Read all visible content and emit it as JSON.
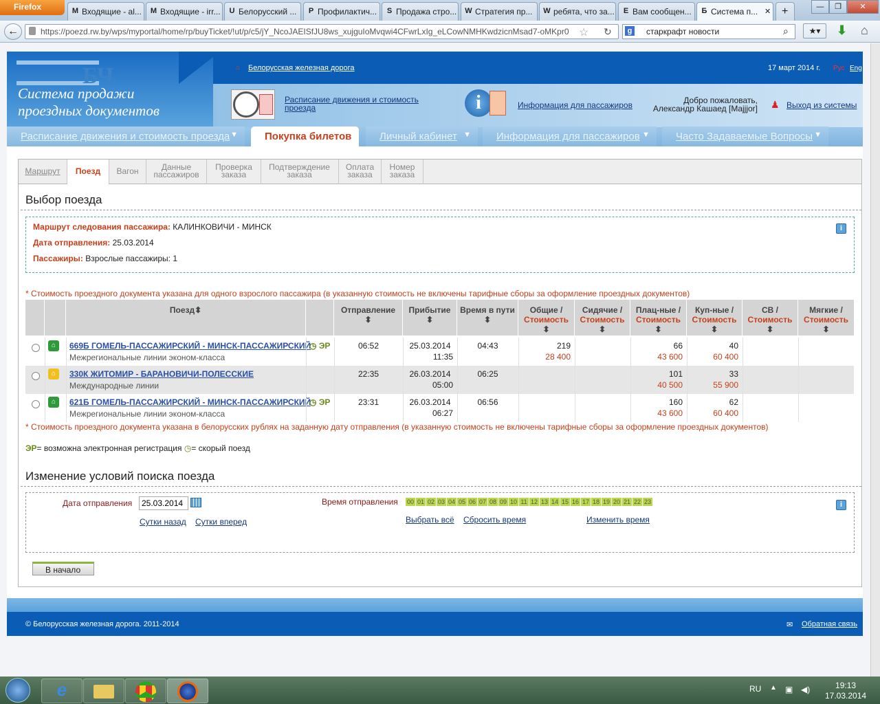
{
  "browser": {
    "app_button": "Firefox",
    "tabs": [
      {
        "label": "Входящие - al...",
        "icon": "M"
      },
      {
        "label": "Входящие - irr...",
        "icon": "M"
      },
      {
        "label": "Белорусский ...",
        "icon": "U"
      },
      {
        "label": "Профилактич...",
        "icon": "P"
      },
      {
        "label": "Продажа стро...",
        "icon": "S"
      },
      {
        "label": "Стратегия пр...",
        "icon": "W"
      },
      {
        "label": "ребята, что за...",
        "icon": "W"
      },
      {
        "label": "Вам сообщен...",
        "icon": "E"
      },
      {
        "label": "Система п...",
        "icon": "Б"
      }
    ],
    "url": "https://poezd.rw.by/wps/myportal/home/rp/buyTicket/!ut/p/c5/jY_NcoJAEISfJU8ws_xujguIoMvqwi4CFwrLxIg_eLCowNMHKwdzicnMsad7-oMKpr0",
    "search_value": "старкрафт новости",
    "accent": "#0a5cb5"
  },
  "portal": {
    "home_link": "Белорусская железная дорога",
    "date": "17 март 2014 г.",
    "lang_ru": "Рус",
    "lang_en": "Eng",
    "logo_text_line1": "Система продажи",
    "logo_text_line2": "проездных документов",
    "logo_mark": "БЧ",
    "schedule_link": "Расписание движения и стоимость проезда",
    "info_link": "Информация для пассажиров",
    "welcome_line1": "Добро пожаловать,",
    "welcome_line2": "Александр Кашаед [Majjjor]",
    "logout": "Выход из системы",
    "nav": [
      "Расписание движения и стоимость проезда",
      "Покупка билетов",
      "Личный кабинет",
      "Информация для пассажиров",
      "Часто Задаваемые Вопросы"
    ]
  },
  "steps": [
    {
      "l1": "Маршрут",
      "l2": ""
    },
    {
      "l1": "Поезд",
      "l2": ""
    },
    {
      "l1": "Вагон",
      "l2": ""
    },
    {
      "l1": "Данные",
      "l2": "пассажиров"
    },
    {
      "l1": "Проверка",
      "l2": "заказа"
    },
    {
      "l1": "Подтверждение",
      "l2": "заказа"
    },
    {
      "l1": "Оплата",
      "l2": "заказа"
    },
    {
      "l1": "Номер",
      "l2": "заказа"
    }
  ],
  "select": {
    "title": "Выбор поезда",
    "route_label": "Маршрут следования пассажира:",
    "route_value": "КАЛИНКОВИЧИ - МИНСК",
    "date_label": "Дата отправления:",
    "date_value": "25.03.2014",
    "pass_label": "Пассажиры:",
    "pass_value": "Взрослые пассажиры: 1",
    "note_top": "* Стоимость проездного документа указана для одного взрослого пассажира (в указанную стоимость не включены тарифные сборы за оформление проездных документов)",
    "note_bottom": "* Стоимость проездного документа указана в белорусских рублях на заданную дату отправления (в указанную стоимость не включены тарифные сборы за оформление проездных документов)",
    "legend_er": "ЭР",
    "legend_er_text": "= возможна электронная регистрация",
    "legend_fast_text": "= скорый поезд"
  },
  "table": {
    "headers": {
      "train": "Поезд",
      "dep": "Отправление",
      "arr": "Прибытие",
      "dur": "Время в пути",
      "c1a": "Общие /",
      "c1b": "Стоимость",
      "c2a": "Сидячие /",
      "c2b": "Стоимость",
      "c3a": "Плац-ные /",
      "c3b": "Стоимость",
      "c4a": "Куп-ные /",
      "c4b": "Стоимость",
      "c5a": "СВ /",
      "c5b": "Стоимость",
      "c6a": "Мягкие /",
      "c6b": "Стоимость"
    },
    "rows": [
      {
        "name": "669Б ГОМЕЛЬ-ПАССАЖИРСКИЙ - МИНСК-ПАССАЖИРСКИЙ",
        "sub": "Межрегиональные линии эконом-класса",
        "er": "ЭР",
        "dep": "06:52",
        "arr_date": "25.03.2014",
        "arr_time": "11:35",
        "dur": "04:43",
        "c1": "219",
        "c1p": "28 400",
        "c3": "66",
        "c3p": "43 600",
        "c4": "40",
        "c4p": "60 400",
        "icon_color": "#2e9a3a"
      },
      {
        "name": "330К ЖИТОМИР - БАРАНОВИЧИ-ПОЛЕССКИЕ",
        "sub": "Международные линии",
        "er": "",
        "dep": "22:35",
        "arr_date": "26.03.2014",
        "arr_time": "05:00",
        "dur": "06:25",
        "c1": "",
        "c1p": "",
        "c3": "101",
        "c3p": "40 500",
        "c4": "33",
        "c4p": "55 900",
        "icon_color": "#f0c020"
      },
      {
        "name": "621Б ГОМЕЛЬ-ПАССАЖИРСКИЙ - МИНСК-ПАССАЖИРСКИЙ",
        "sub": "Межрегиональные линии эконом-класса",
        "er": "ЭР",
        "dep": "23:31",
        "arr_date": "26.03.2014",
        "arr_time": "06:27",
        "dur": "06:56",
        "c1": "",
        "c1p": "",
        "c3": "160",
        "c3p": "43 600",
        "c4": "62",
        "c4p": "60 400",
        "icon_color": "#2e9a3a"
      }
    ]
  },
  "change": {
    "title": "Изменение условий поиска поезда",
    "date_label": "Дата отправления",
    "date_value": "25.03.2014",
    "prev_day": "Сутки назад",
    "next_day": "Сутки вперед",
    "time_label": "Время отправления",
    "hours": [
      "00",
      "01",
      "02",
      "03",
      "04",
      "05",
      "06",
      "07",
      "08",
      "09",
      "10",
      "11",
      "12",
      "13",
      "14",
      "15",
      "16",
      "17",
      "18",
      "19",
      "20",
      "21",
      "22",
      "23"
    ],
    "select_all": "Выбрать всё",
    "reset_time": "Сбросить время",
    "change_time": "Изменить время",
    "back_button": "В начало"
  },
  "footer": {
    "copyright": "© Белорусская железная дорога. 2011-2014",
    "feedback": "Обратная связь"
  },
  "taskbar": {
    "lang": "RU",
    "time": "19:13",
    "date": "17.03.2014"
  }
}
